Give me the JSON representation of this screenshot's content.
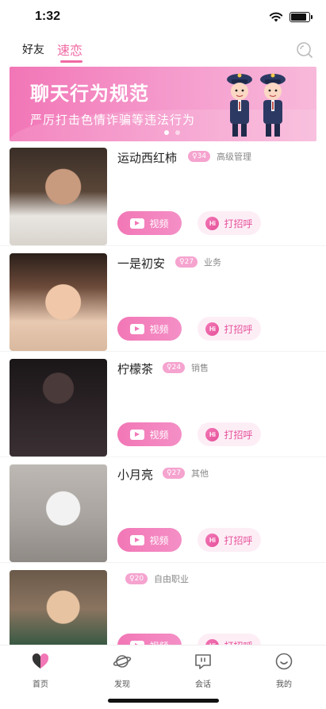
{
  "status_bar": {
    "time": "1:32"
  },
  "top_tabs": {
    "friends": "好友",
    "speed_love": "速恋"
  },
  "banner": {
    "title": "聊天行为规范",
    "subtitle": "严厉打击色情诈骗等违法行为"
  },
  "colors": {
    "accent": "#f06aa3",
    "badge": "#f5a3cf",
    "greet_bg": "#fdeef6"
  },
  "profiles": [
    {
      "name": "运动西红柿",
      "age": "34",
      "job": "高级管理",
      "video_label": "视频",
      "greet_label": "打招呼"
    },
    {
      "name": "一是初安",
      "age": "27",
      "job": "业务",
      "video_label": "视频",
      "greet_label": "打招呼"
    },
    {
      "name": "柠檬茶",
      "age": "24",
      "job": "销售",
      "video_label": "视频",
      "greet_label": "打招呼"
    },
    {
      "name": "小月亮",
      "age": "27",
      "job": "其他",
      "video_label": "视频",
      "greet_label": "打招呼"
    },
    {
      "name": "",
      "age": "20",
      "job": "自由职业",
      "video_label": "视频",
      "greet_label": "打招呼"
    }
  ],
  "bottom_nav": {
    "items": [
      {
        "label": "首页",
        "icon": "home-heart-icon"
      },
      {
        "label": "发现",
        "icon": "planet-icon"
      },
      {
        "label": "会话",
        "icon": "chat-icon"
      },
      {
        "label": "我的",
        "icon": "profile-icon"
      }
    ]
  }
}
